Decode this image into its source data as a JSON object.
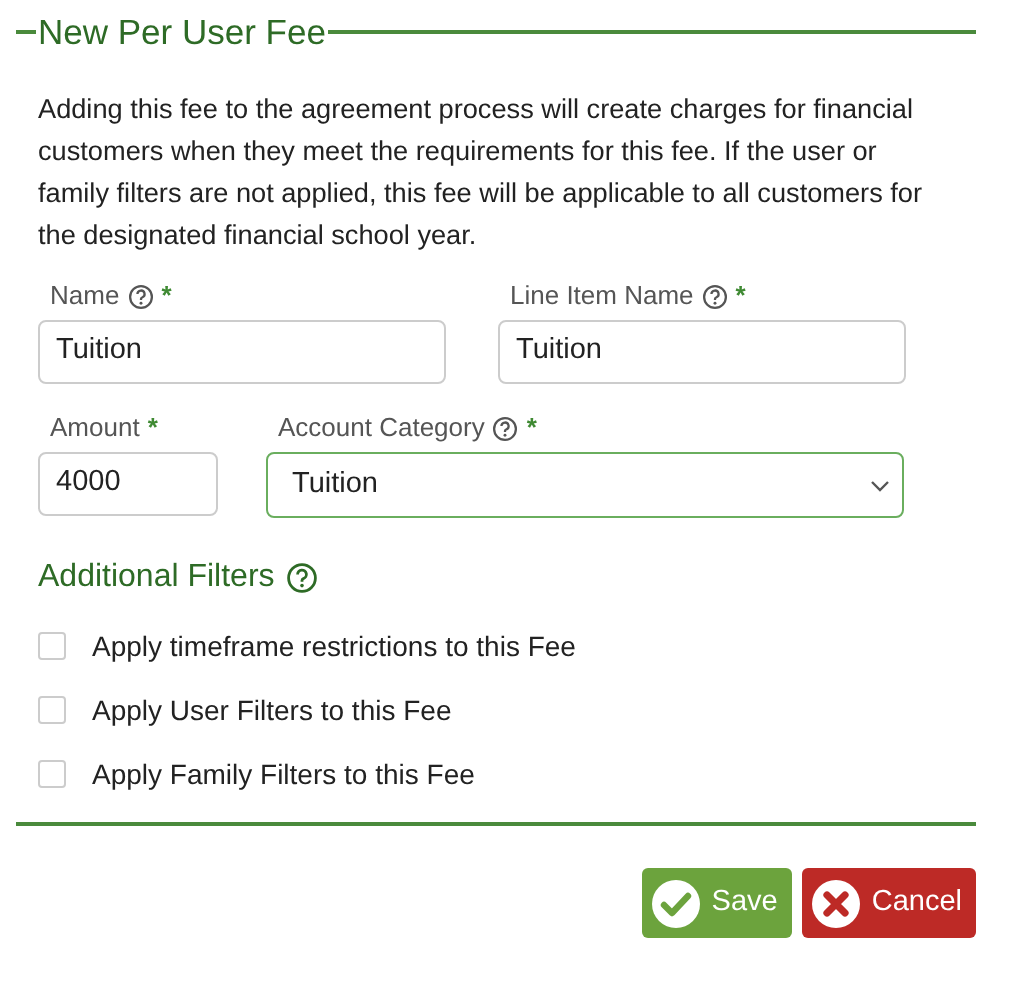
{
  "title": "New Per User Fee",
  "description": "Adding this fee to the agreement process will create charges for financial customers when they meet the requirements for this fee. If the user or family filters are not applied, this fee will be applicable to all customers for the designated financial school year.",
  "field_rows": [
    [
      {
        "kind": "text",
        "label": "Name",
        "help": true,
        "required_mark": "*",
        "value": "Tuition"
      },
      {
        "kind": "text",
        "label": "Line Item Name",
        "help": true,
        "required_mark": "*",
        "value": "Tuition"
      }
    ],
    [
      {
        "kind": "text",
        "label": "Amount",
        "help": false,
        "required_mark": "*",
        "value": "4000"
      },
      {
        "kind": "select",
        "label": "Account Category",
        "help": true,
        "required_mark": "*",
        "value": "Tuition"
      }
    ]
  ],
  "filters": {
    "heading": "Additional Filters",
    "help": true,
    "options": [
      {
        "label": "Apply timeframe restrictions to this Fee",
        "checked": false
      },
      {
        "label": "Apply User Filters to this Fee",
        "checked": false
      },
      {
        "label": "Apply Family Filters to this Fee",
        "checked": false
      }
    ]
  },
  "buttons": [
    {
      "kind": "save",
      "label": "Save"
    },
    {
      "kind": "cancel",
      "label": "Cancel"
    }
  ]
}
